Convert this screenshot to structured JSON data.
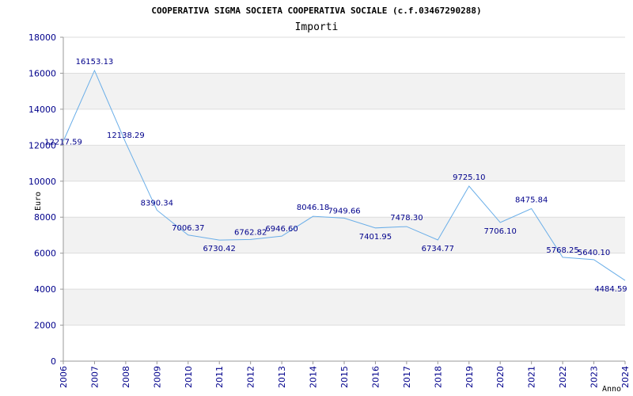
{
  "chart_data": {
    "type": "line",
    "title": "COOPERATIVA SIGMA SOCIETA COOPERATIVA SOCIALE (c.f.03467290288)",
    "subtitle": "Importi",
    "xlabel": "Anno",
    "ylabel": "Euro",
    "ylim": [
      0,
      18000
    ],
    "yticks": [
      0,
      2000,
      4000,
      6000,
      8000,
      10000,
      12000,
      14000,
      16000,
      18000
    ],
    "x": [
      "2006",
      "2007",
      "2008",
      "2009",
      "2010",
      "2011",
      "2012",
      "2013",
      "2014",
      "2015",
      "2016",
      "2017",
      "2018",
      "2019",
      "2020",
      "2021",
      "2022",
      "2023",
      "2024"
    ],
    "values": [
      12217.59,
      16153.13,
      12138.29,
      8390.34,
      7006.37,
      6730.42,
      6762.82,
      6946.6,
      8046.18,
      7949.66,
      7401.95,
      7478.3,
      6734.77,
      9725.1,
      7706.1,
      8475.84,
      5768.25,
      5640.1,
      4484.59
    ],
    "value_labels": [
      "12217.59",
      "16153.13",
      "12138.29",
      "8390.34",
      "7006.37",
      "6730.42",
      "6762.82",
      "6946.60",
      "8046.18",
      "7949.66",
      "7401.95",
      "7478.30",
      "6734.77",
      "9725.10",
      "7706.10",
      "8475.84",
      "5768.25",
      "5640.10",
      "4484.59"
    ],
    "grid": true,
    "colors": {
      "line": "#6aaee8",
      "band": "#f2f2f2",
      "grid": "#dddddd",
      "tick_text": "#00008b",
      "axis": "#999999"
    }
  }
}
